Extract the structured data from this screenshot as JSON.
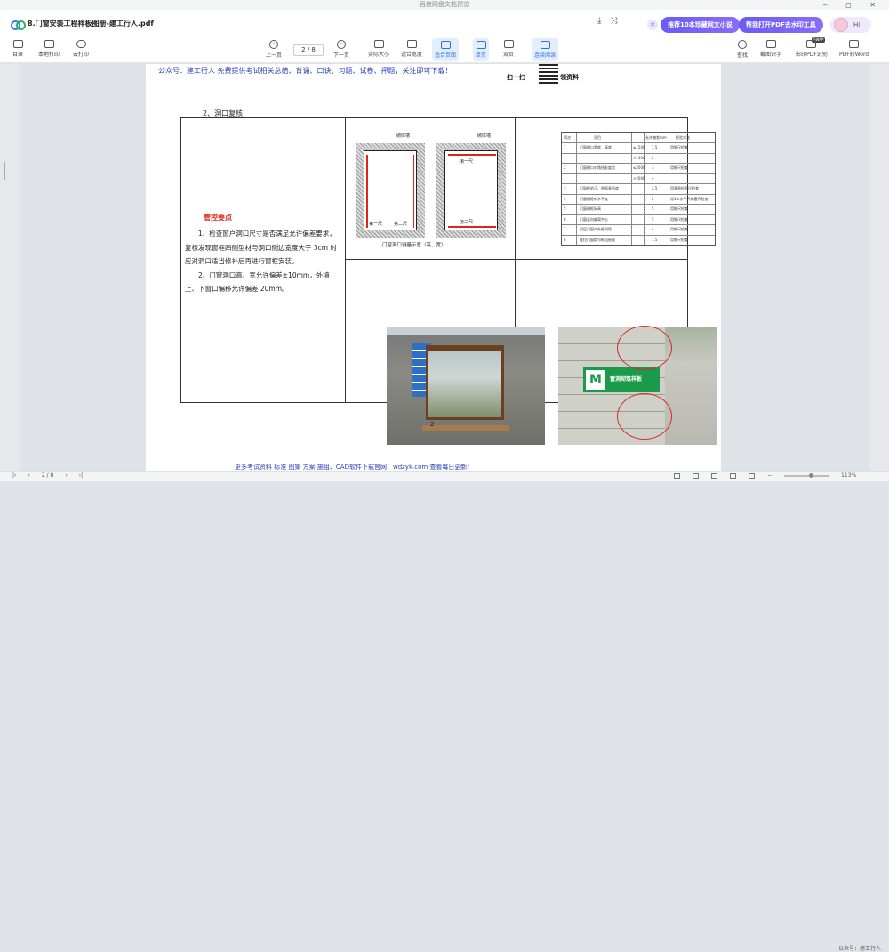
{
  "window": {
    "title": "百度网盘文档预览",
    "controls": "‒ ◻ ✕"
  },
  "tab": {
    "filename": "8.门窗安装工程样板图册-建工行人.pdf"
  },
  "promos": {
    "novel": "推荐10本珍藏网文小说",
    "watermark": "帮我打开PDF去水印工具",
    "hi": "Hi"
  },
  "toolbar": {
    "catalog": "目录",
    "local_print": "本地打印",
    "cloud_print": "云打印",
    "prev_page": "上一页",
    "page_indicator": "2 / 8",
    "next_page": "下一页",
    "actual_size": "实际大小",
    "fit_width": "适合宽度",
    "fit_page": "适合页面",
    "single_page": "单页",
    "double_page": "双页",
    "continuous": "连续阅读",
    "search": "查找",
    "ocr": "截图识字",
    "pdf_ocr": "影印PDF识别",
    "pdf_to_word": "PDF转Word",
    "swap_badge": "SWAP"
  },
  "document": {
    "header_note": "公众号：建工行人 免费提供考试相关总结、背诵、口诀、习题、试卷、押题，关注即可下载！",
    "qr_left": "扫一扫",
    "qr_right": "领资料",
    "section_title": "2、洞口复核",
    "key_points_title": "管控要点",
    "key_points_body_1": "1、检查窗户洞口尺寸是否满足允许偏差要求，复核发现窗框四侧型材与洞口侧边宽度大于 3cm 时应对洞口适当修补后再进行窗框安装。",
    "key_points_body_2": "2、门窗洞口高、宽允许偏差±10mm，外墙上、下窗口偏移允许偏差 20mm。",
    "diagram": {
      "wall_label_1": "砌体墙",
      "wall_label_2": "砌体墙",
      "ruler_1": "第一尺",
      "ruler_2": "第二尺",
      "ruler_3": "第一尺",
      "ruler_4": "第二尺",
      "caption": "门窗洞口测量示意（高、宽）"
    },
    "table": {
      "headers": [
        "项次",
        "项目",
        "允许偏差mm",
        "检验方法"
      ],
      "rows": [
        [
          "1",
          "门窗槽口宽度、高度",
          "≤1500",
          "1.5",
          "用钢尺检查"
        ],
        [
          "",
          "",
          ">1500",
          "2",
          ""
        ],
        [
          "2",
          "门窗槽口对角线长度差",
          "≤2000",
          "3",
          "用钢尺检查"
        ],
        [
          "",
          "",
          ">2000",
          "4",
          ""
        ],
        [
          "3",
          "门窗框的正、侧面垂直度",
          "",
          "2.5",
          "用垂直检测尺检查"
        ],
        [
          "4",
          "门窗横框的水平度",
          "",
          "2",
          "用1m水平尺和塞尺检查"
        ],
        [
          "5",
          "门窗横框标高",
          "",
          "5",
          "用钢尺检查"
        ],
        [
          "6",
          "门窗竖向偏离中心",
          "",
          "5",
          "用钢尺检查"
        ],
        [
          "7",
          "双层门窗内外框间距",
          "",
          "4",
          "用钢尺检查"
        ],
        [
          "8",
          "推拉门窗扇与框搭接量",
          "",
          "1.5",
          "用钢尺检查"
        ]
      ]
    },
    "sign_text": "窗洞砌筑样板",
    "sign_logo": "M",
    "page_number": "2",
    "footer": "更多考试资料 标准 图集 方案 施组、CAD软件下载官网：wdzyk.com 查看每日更新！"
  },
  "statusbar": {
    "page": "2 / 8",
    "zoom": "113%",
    "watermark": "公众号：建工行人"
  }
}
